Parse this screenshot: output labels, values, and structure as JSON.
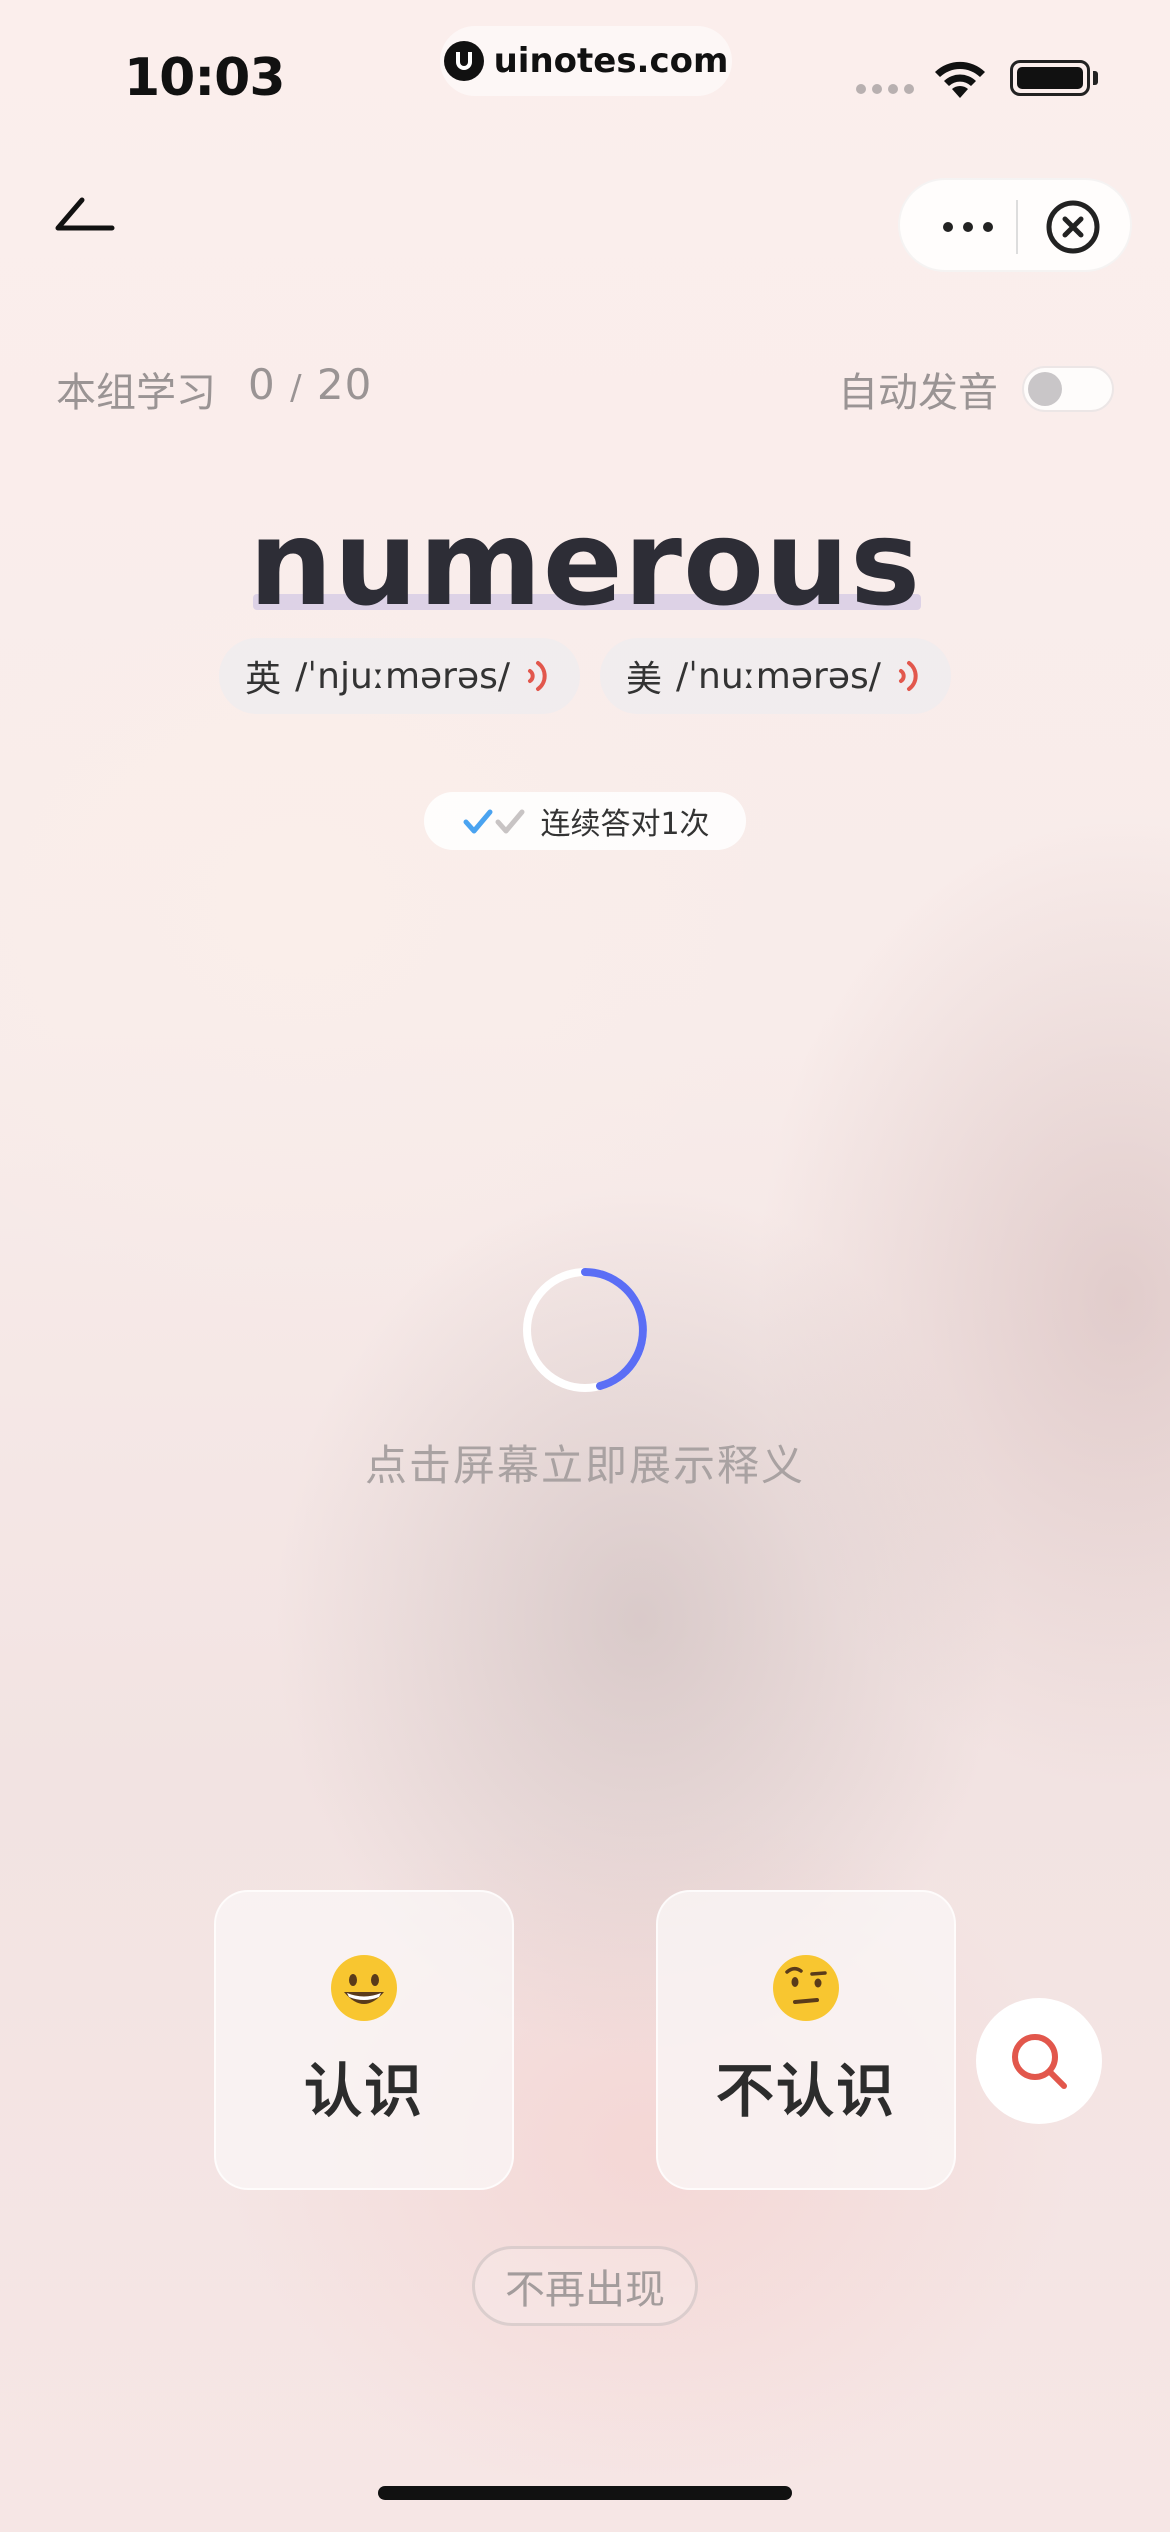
{
  "status_bar": {
    "time": "10:03",
    "url": "uinotes.com"
  },
  "progress": {
    "label": "本组学习",
    "current": "0",
    "separator": "/",
    "total": "20"
  },
  "auto_pronounce": {
    "label": "自动发音",
    "enabled": false
  },
  "word": {
    "text": "numerous",
    "phonetics": [
      {
        "lang": "英",
        "ipa": "/ˈnjuːmərəs/"
      },
      {
        "lang": "美",
        "ipa": "/ˈnuːmərəs/"
      }
    ]
  },
  "streak": {
    "text": "连续答对1次"
  },
  "hint": "点击屏幕立即展示释义",
  "buttons": {
    "know": "认识",
    "unknown": "不认识",
    "never": "不再出现"
  },
  "colors": {
    "accent_blue": "#5b6ef5",
    "speaker_red": "#e2574c",
    "search_red": "#e2574c",
    "check_blue": "#4aa3f0"
  }
}
